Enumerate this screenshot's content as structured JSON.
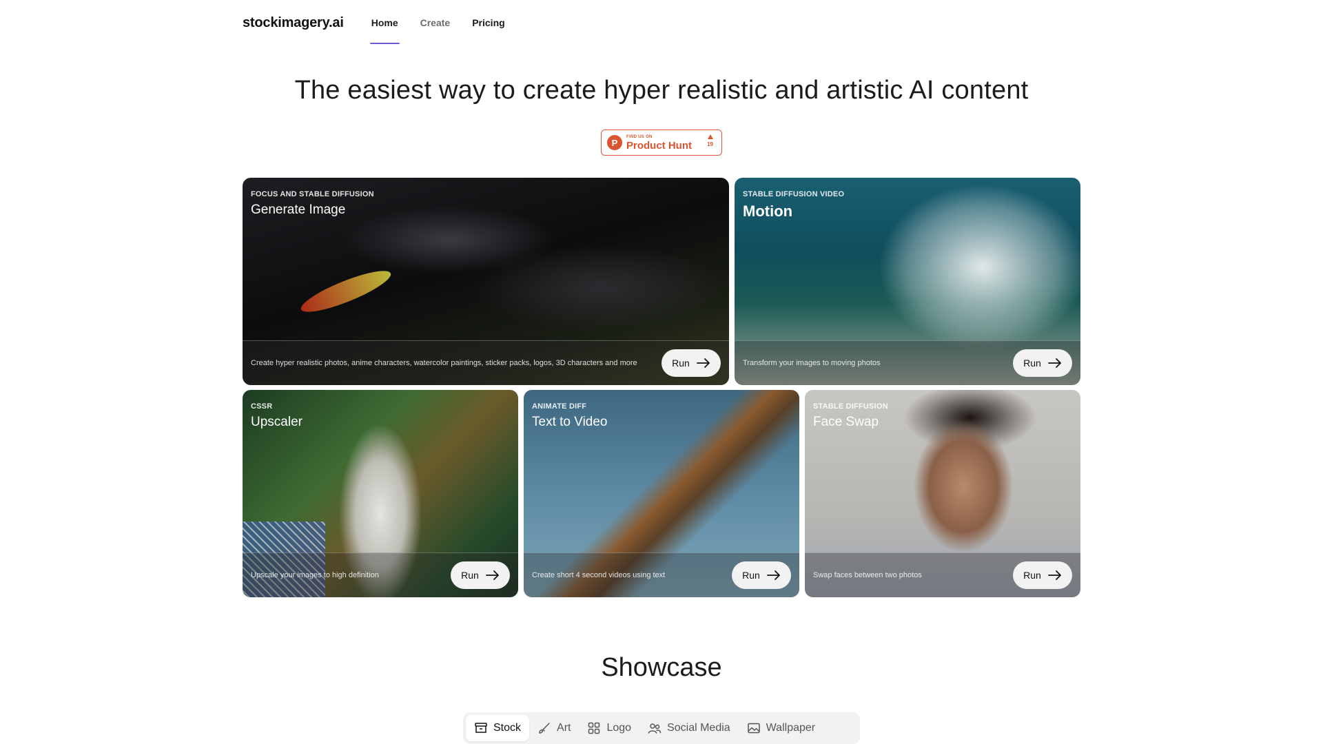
{
  "nav": {
    "brand": "stockimagery.ai",
    "links": [
      {
        "label": "Home",
        "active": true
      },
      {
        "label": "Create",
        "active": false
      },
      {
        "label": "Pricing",
        "active": false
      }
    ],
    "accent_color": "#6a5cd6"
  },
  "hero": {
    "title": "The easiest way to create hyper realistic and artistic AI content",
    "product_hunt": {
      "small_text": "FIND US ON",
      "big_text": "Product Hunt",
      "votes": "19",
      "color": "#da552f"
    }
  },
  "cards": {
    "generate": {
      "kicker": "Focus and Stable Diffusion",
      "title": "Generate Image",
      "description": "Create hyper realistic photos, anime characters, watercolor paintings, sticker packs, logos, 3D characters and more",
      "button": "Run"
    },
    "motion": {
      "kicker": "Stable Diffusion Video",
      "title": "Motion",
      "description": "Transform your images to moving photos",
      "button": "Run"
    },
    "upscaler": {
      "kicker": "CSSR",
      "title": "Upscaler",
      "description": "Upscale your images to high definition",
      "button": "Run"
    },
    "text_to_video": {
      "kicker": "Animate Diff",
      "title": "Text to Video",
      "description": "Create short 4 second videos using text",
      "button": "Run"
    },
    "face_swap": {
      "kicker": "Stable Diffusion",
      "title": "Face Swap",
      "description": "Swap faces between two photos",
      "button": "Run"
    }
  },
  "showcase": {
    "title": "Showcase",
    "tabs": [
      {
        "label": "Stock",
        "icon": "archive-box-icon",
        "active": true
      },
      {
        "label": "Art",
        "icon": "brush-icon",
        "active": false
      },
      {
        "label": "Logo",
        "icon": "grid-icon",
        "active": false
      },
      {
        "label": "Social Media",
        "icon": "users-icon",
        "active": false
      },
      {
        "label": "Wallpaper",
        "icon": "image-icon",
        "active": false
      }
    ]
  }
}
